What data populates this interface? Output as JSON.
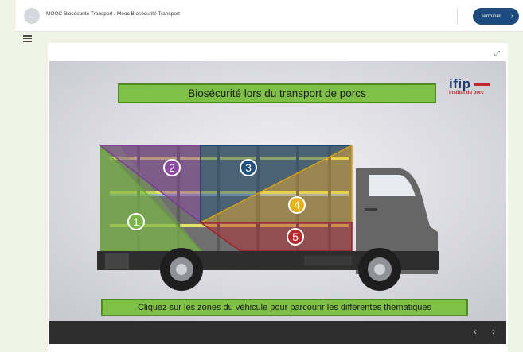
{
  "topbar": {
    "back_icon": "arrow-left-icon",
    "breadcrumb": "MOOC Biosécurité Transport / Mooc Biosécurité Transport",
    "finish_label": "Terminer",
    "finish_icon": "chevron-right-icon",
    "accent_color": "#1d4b7d"
  },
  "sidebar": {
    "menu_icon": "hamburger-icon"
  },
  "card": {
    "fullscreen_icon": "expand-icon"
  },
  "slide": {
    "title": "Biosécurité lors du transport de porcs",
    "logo_text": "ifip",
    "logo_subtitle": "Institut du porc",
    "footer": "Cliquez sur les zones du véhicule pour parcourir les différentes thématiques",
    "zones": [
      {
        "number": "1",
        "color": "#7ab648"
      },
      {
        "number": "2",
        "color": "#8e4aa3"
      },
      {
        "number": "3",
        "color": "#1f4f7a"
      },
      {
        "number": "4",
        "color": "#e9b21c"
      },
      {
        "number": "5",
        "color": "#b8292e"
      }
    ]
  },
  "controls": {
    "prev_icon": "chevron-left-icon",
    "next_icon": "chevron-right-icon"
  }
}
